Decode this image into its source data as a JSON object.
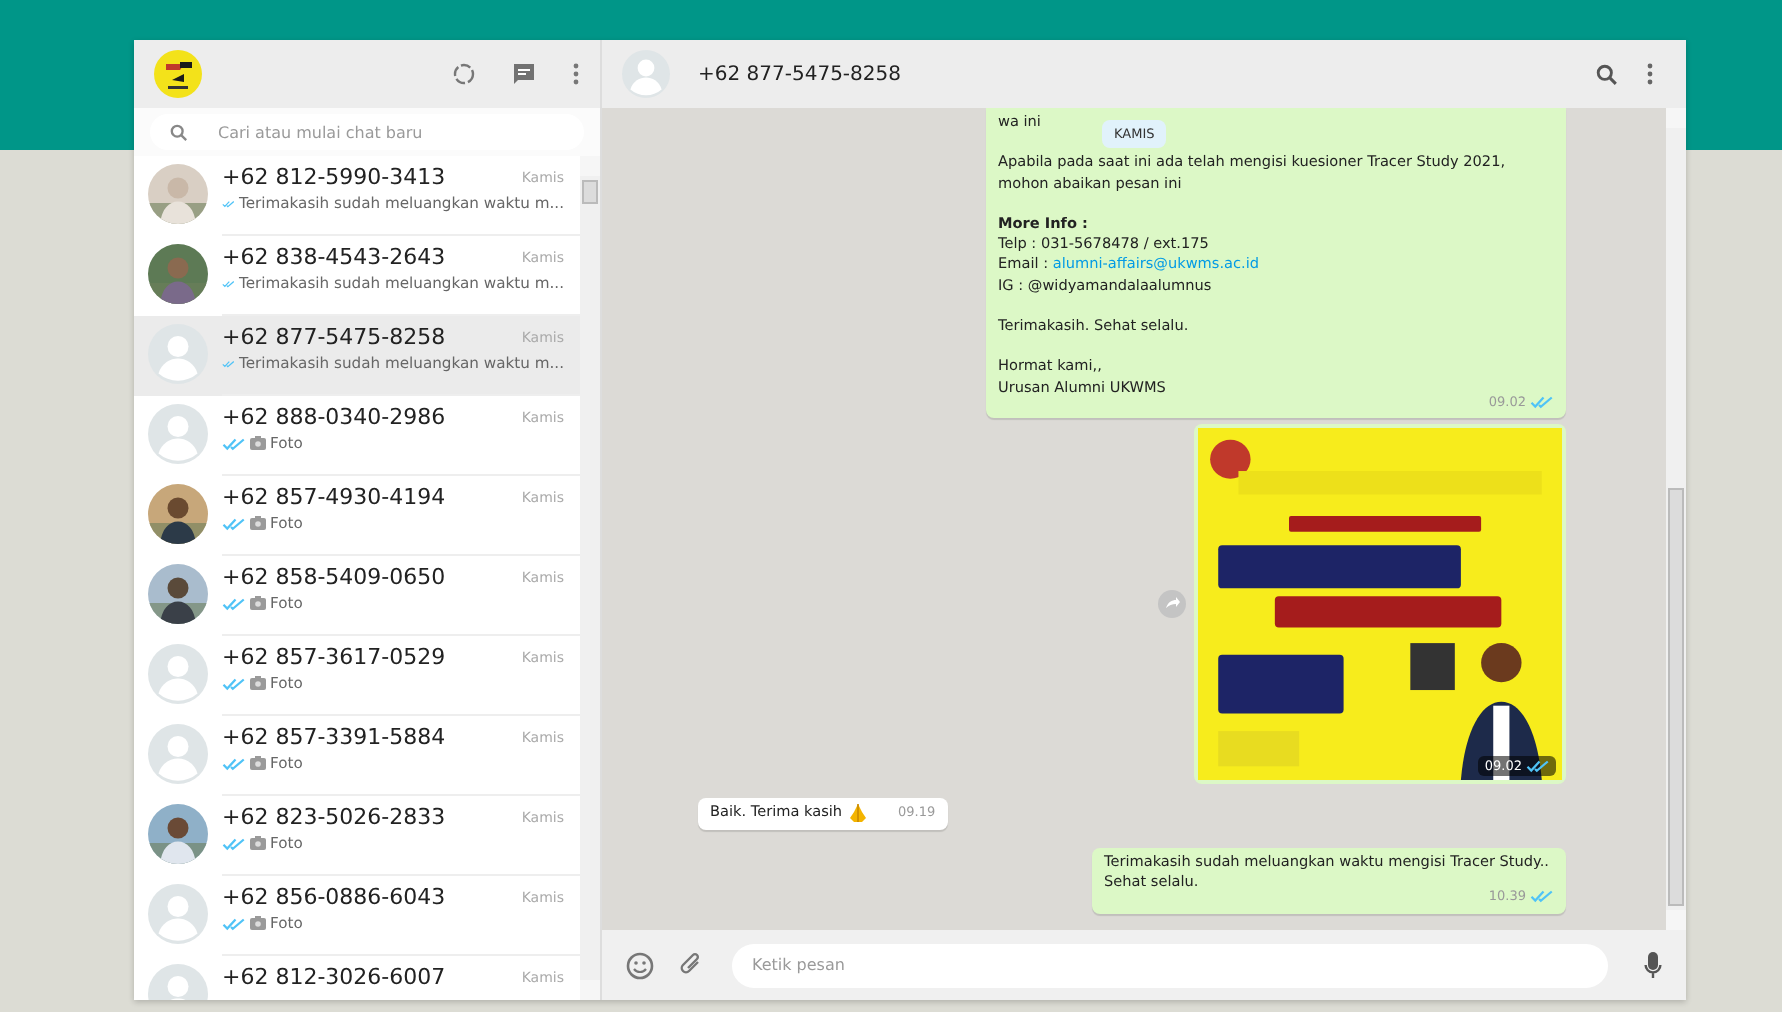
{
  "sidebar": {
    "search": {
      "placeholder": "Cari atau mulai chat baru"
    },
    "chats": [
      {
        "name": "+62 812-5990-3413",
        "time": "Kamis",
        "preview": {
          "kind": "text",
          "text": "Terimakasih sudah meluangkan waktu m..."
        },
        "read": true,
        "selected": false
      },
      {
        "name": "+62 838-4543-2643",
        "time": "Kamis",
        "preview": {
          "kind": "text",
          "text": "Terimakasih sudah meluangkan waktu m..."
        },
        "read": true,
        "selected": false
      },
      {
        "name": "+62 877-5475-8258",
        "time": "Kamis",
        "preview": {
          "kind": "text",
          "text": "Terimakasih sudah meluangkan waktu m..."
        },
        "avatar": {
          "kind": "default"
        },
        "read": true,
        "selected": true
      },
      {
        "name": "+62 888-0340-2986",
        "time": "Kamis",
        "preview": {
          "text": "Foto"
        },
        "avatar": {
          "kind": "default"
        },
        "read": true,
        "selected": false
      },
      {
        "name": "+62 857-4930-4194",
        "time": "Kamis",
        "preview": {
          "text": "Foto"
        },
        "read": true,
        "selected": false
      },
      {
        "name": "+62 858-5409-0650",
        "time": "Kamis",
        "preview": {
          "text": "Foto"
        },
        "read": true,
        "selected": false
      },
      {
        "name": "+62 857-3617-0529",
        "time": "Kamis",
        "preview": {
          "text": "Foto"
        },
        "avatar": {
          "kind": "default"
        },
        "read": true,
        "selected": false
      },
      {
        "name": "+62 857-3391-5884",
        "time": "Kamis",
        "preview": {
          "text": "Foto"
        },
        "avatar": {
          "kind": "default"
        },
        "read": true,
        "selected": false
      },
      {
        "name": "+62 823-5026-2833",
        "time": "Kamis",
        "preview": {
          "text": "Foto"
        },
        "read": true,
        "selected": false
      },
      {
        "name": "+62 856-0886-6043",
        "time": "Kamis",
        "preview": {
          "text": "Foto"
        },
        "avatar": {
          "kind": "default"
        },
        "read": true,
        "selected": false
      },
      {
        "name": "+62 812-3026-6007",
        "time": "Kamis",
        "avatar": {
          "kind": "default"
        },
        "selected": false
      }
    ]
  },
  "chat": {
    "header": {
      "name": "+62 877-5475-8258"
    },
    "date_chip": "KAMIS",
    "messages": [
      {
        "kind": "text",
        "outgoing": true,
        "paragraphs": [
          [
            {
              "kind": "text",
              "text": "wa ini"
            }
          ],
          [
            {
              "kind": "text",
              "text": "Apabila pada saat ini ada telah mengisi kuesioner Tracer Study 2021, mohon abaikan pesan ini"
            }
          ],
          [
            {
              "kind": "heading",
              "text": "More Info :"
            },
            {
              "kind": "text",
              "text": "Telp : 031-5678478 / ext.175"
            },
            {
              "kind": "link",
              "label": "Email :",
              "text": "alumni-affairs@ukwms.ac.id"
            },
            {
              "kind": "text",
              "text": "IG : @widyamandalaalumnus"
            }
          ],
          [
            {
              "kind": "text",
              "text": "Terimakasih.  Sehat selalu."
            }
          ],
          [
            {
              "kind": "text",
              "text": "Hormat kami,,"
            },
            {
              "kind": "text",
              "text": "Urusan Alumni UKWMS"
            }
          ]
        ],
        "time": "09.02",
        "read": true
      },
      {
        "outgoing": true,
        "time": "09.02",
        "read": true
      },
      {
        "kind": "text",
        "outgoing": false,
        "paragraphs": [
          [
            {
              "kind": "text",
              "text": "Baik. Terima kasih"
            }
          ]
        ],
        "emoji": true,
        "time": "09.19"
      },
      {
        "kind": "text",
        "outgoing": true,
        "paragraphs": [
          [
            {
              "kind": "text",
              "text": "Terimakasih sudah meluangkan waktu mengisi Tracer Study.. Sehat selalu."
            }
          ]
        ],
        "time": "10.39",
        "read": true
      }
    ],
    "composer": {
      "placeholder": "Ketik pesan"
    }
  }
}
